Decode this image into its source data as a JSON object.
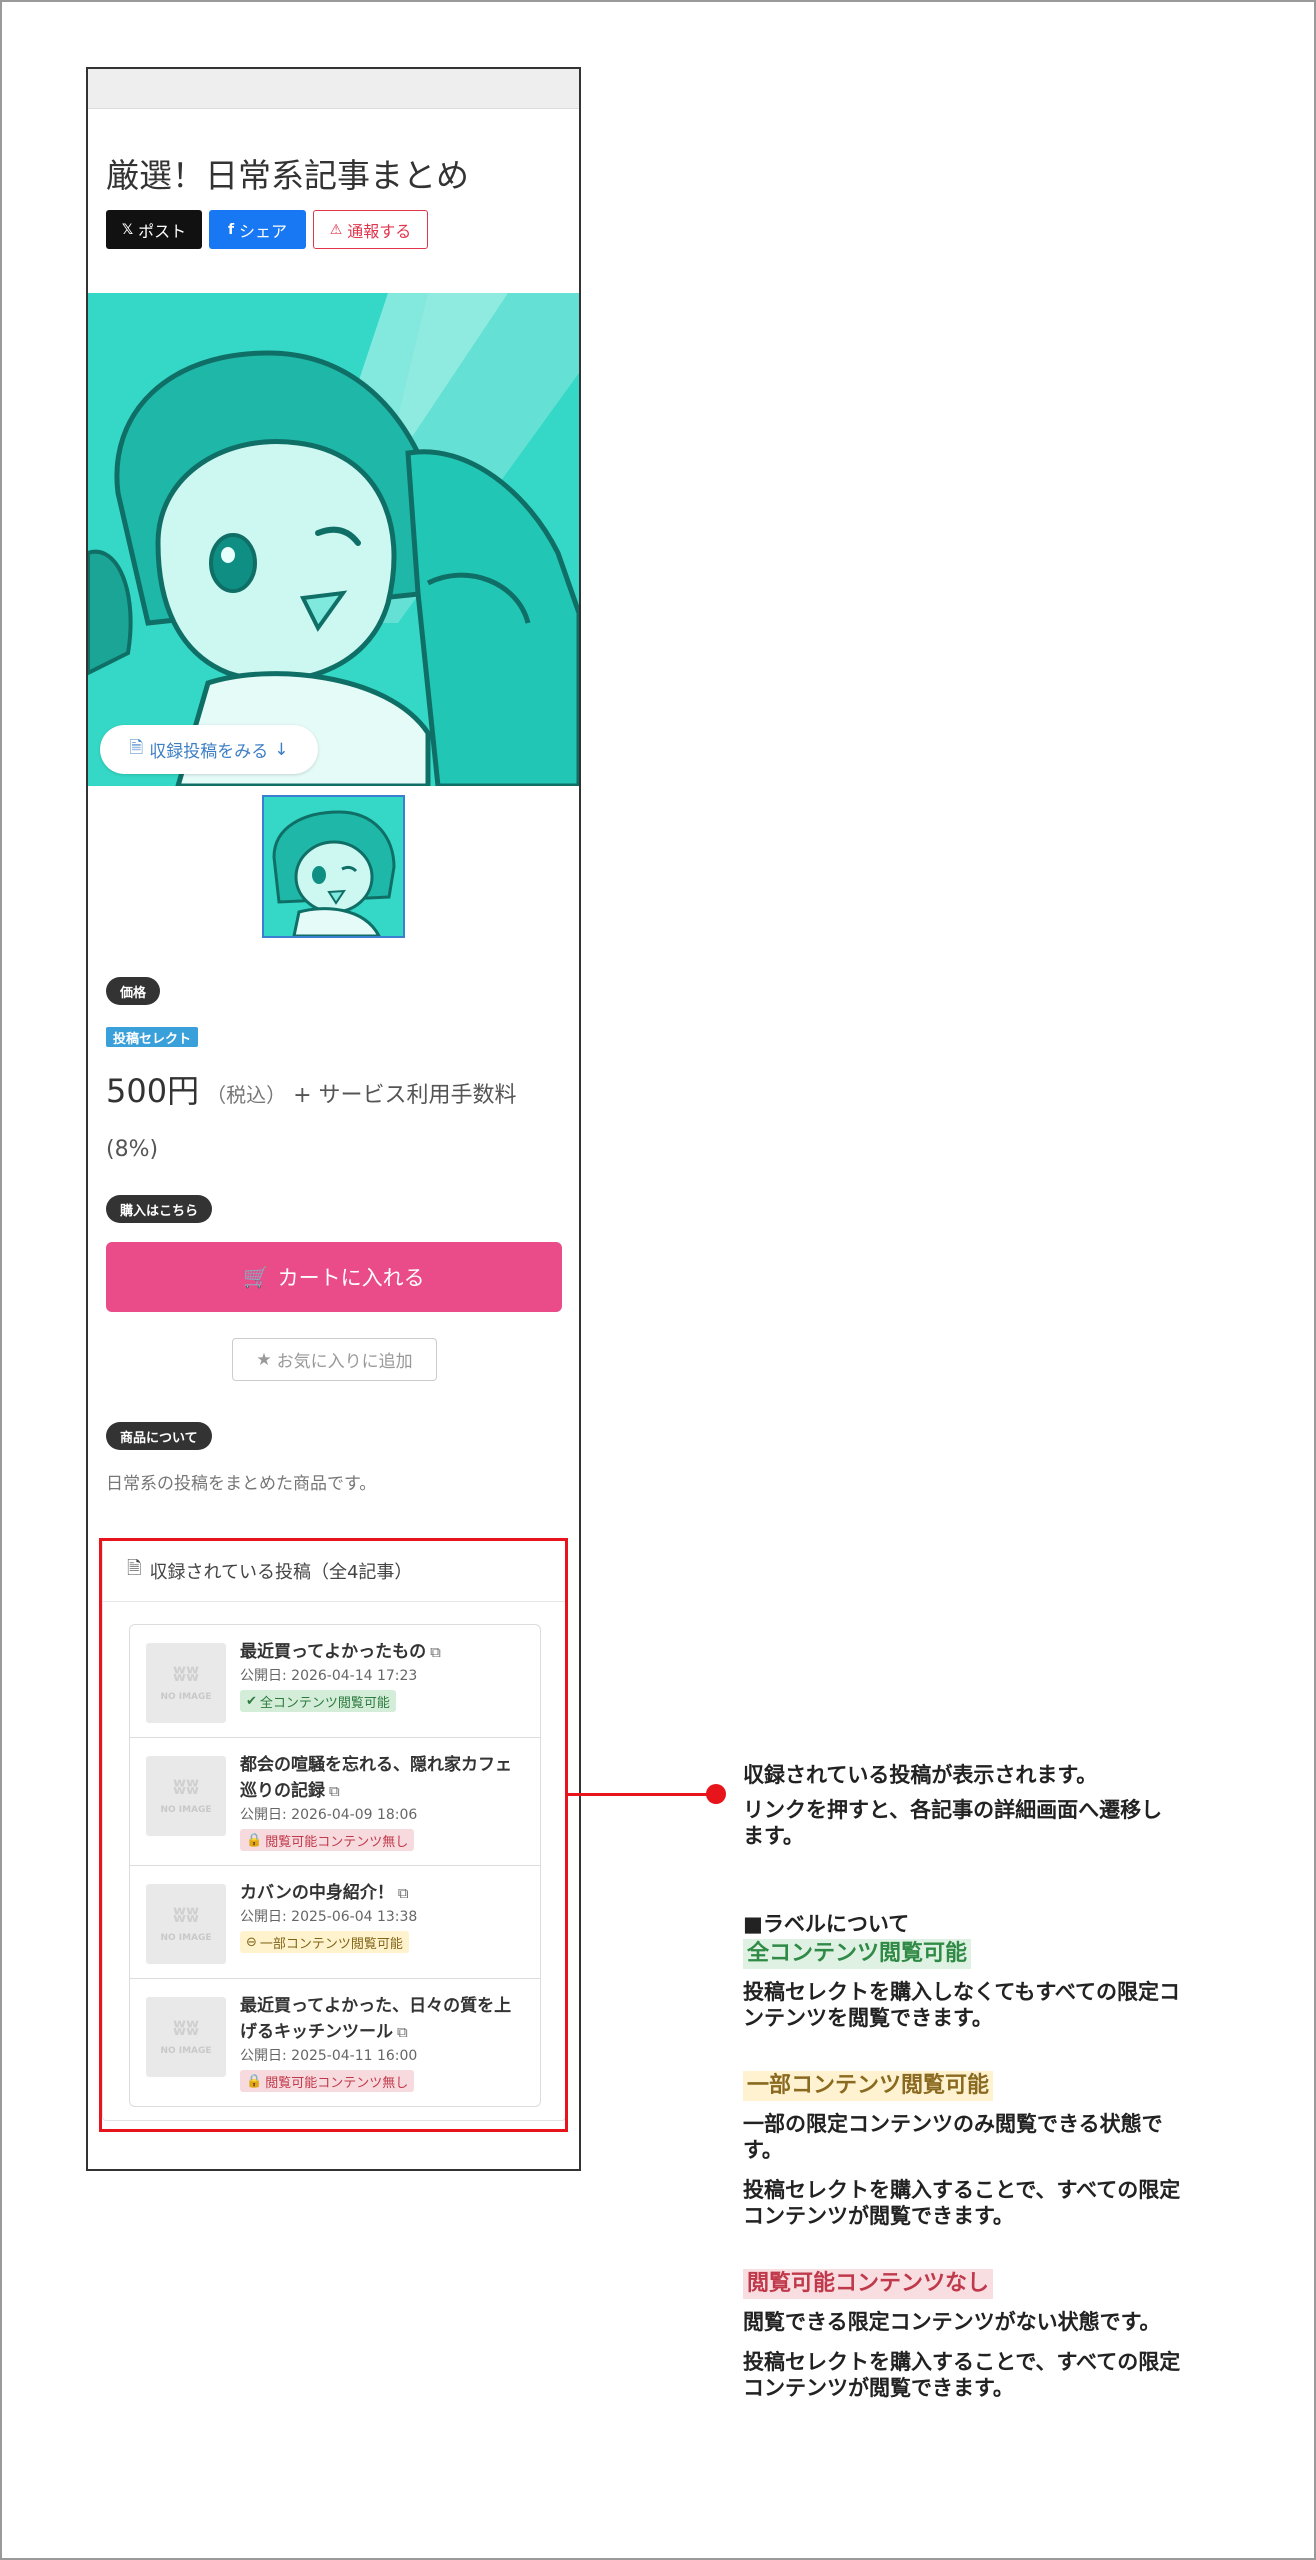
{
  "product": {
    "title": "厳選！日常系記事まとめ",
    "share": {
      "x_label": "ポスト",
      "fb_label": "シェア",
      "report_label": "通報する"
    },
    "view_posts_label": "収録投稿をみる",
    "price_badge": "価格",
    "select_tag": "投稿セレクト",
    "price_amount": "500円",
    "price_tax": "（税込）",
    "price_fee": "+ サービス利用手数料",
    "price_fee_rate": "(8%)",
    "buy_badge": "購入はこちら",
    "cart_label": "カートに入れる",
    "fav_label": "お気に入りに追加",
    "about_badge": "商品について",
    "description": "日常系の投稿をまとめた商品です。"
  },
  "posts": {
    "header": "収録されている投稿（全4記事）",
    "noimage_text": "NO IMAGE",
    "items": [
      {
        "title": "最近買ってよかったもの",
        "date": "公開日: 2026-04-14 17:23",
        "label": "全コンテンツ閲覧可能",
        "label_type": "green"
      },
      {
        "title": "都会の喧騒を忘れる、隠れ家カフェ巡りの記録",
        "date": "公開日: 2026-04-09 18:06",
        "label": "閲覧可能コンテンツ無し",
        "label_type": "red"
      },
      {
        "title": "カバンの中身紹介！",
        "date": "公開日: 2025-06-04 13:38",
        "label": "一部コンテンツ閲覧可能",
        "label_type": "yellow"
      },
      {
        "title": "最近買ってよかった、日々の質を上げるキッチンツール",
        "date": "公開日: 2025-04-11 16:00",
        "label": "閲覧可能コンテンツ無し",
        "label_type": "red"
      }
    ]
  },
  "annotation": {
    "line1": "収録されている投稿が表示されます。",
    "line2": "リンクを押すと、各記事の詳細画面へ遷移します。",
    "label_heading": "■ラベルについて",
    "full_label": "全コンテンツ閲覧可能",
    "full_desc": "投稿セレクトを購入しなくてもすべての限定コンテンツを閲覧できます。",
    "partial_label": "一部コンテンツ閲覧可能",
    "partial_desc1": "一部の限定コンテンツのみ閲覧できる状態です。",
    "partial_desc2": "投稿セレクトを購入することで、すべての限定コンテンツが閲覧できます。",
    "none_label": "閲覧可能コンテンツなし",
    "none_desc1": "閲覧できる限定コンテンツがない状態です。",
    "none_desc2": "投稿セレクトを購入することで、すべての限定コンテンツが閲覧できます。"
  },
  "colors": {
    "accent_pink": "#ea4b89",
    "highlight_red": "#e8141c",
    "hero_teal": "#2fd4c2"
  }
}
